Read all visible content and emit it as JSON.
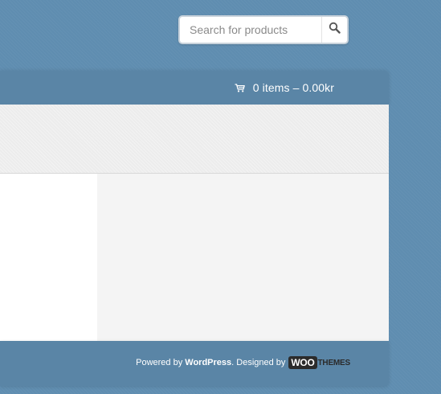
{
  "search": {
    "placeholder": "Search for products",
    "icon": "magnifier-icon"
  },
  "header": {
    "cart_text": "0 items – 0.00kr",
    "cart_icon": "cart-icon"
  },
  "footer": {
    "powered_by": "Powered by",
    "wordpress": "WordPress",
    "designed_by": ". Designed by",
    "logo_woo": "WOO",
    "logo_themes": "THEMES"
  },
  "colors": {
    "background": "#5f8db0",
    "bar": "#5a85a6",
    "band": "#ececec",
    "content_left": "#ffffff",
    "content_right": "#f4f4f4"
  }
}
